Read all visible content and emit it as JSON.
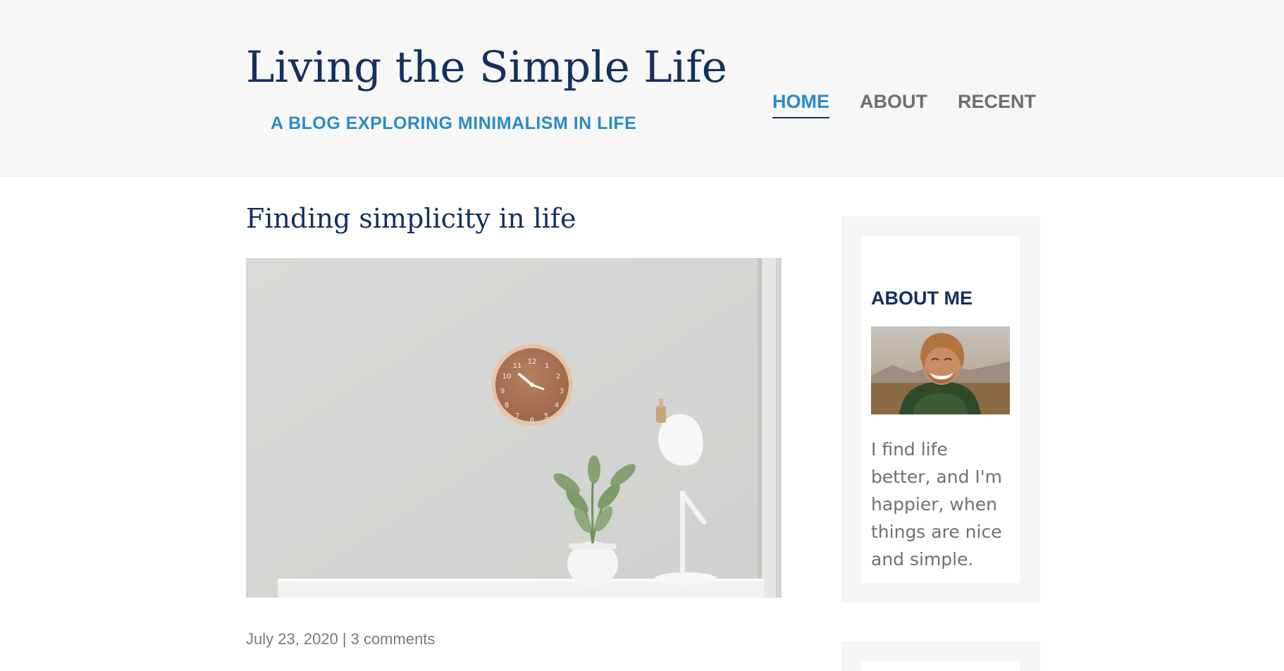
{
  "header": {
    "title": "Living the Simple Life",
    "tagline": "A BLOG EXPLORING MINIMALISM IN LIFE"
  },
  "nav": {
    "items": [
      {
        "label": "HOME",
        "active": true
      },
      {
        "label": "ABOUT",
        "active": false
      },
      {
        "label": "RECENT",
        "active": false
      }
    ]
  },
  "post": {
    "title": "Finding simplicity in life",
    "date": "July 23, 2020",
    "separator": "|",
    "comments": "3 comments"
  },
  "sidebar": {
    "about": {
      "title": "ABOUT ME",
      "bio": "I find life better, and I'm happier, when things are nice and simple."
    }
  },
  "colors": {
    "header_bg": "#f7f7f7",
    "title": "#13305f",
    "accent": "#2a8bc9",
    "nav_text": "#6e6e6e",
    "body_text": "#707070"
  }
}
